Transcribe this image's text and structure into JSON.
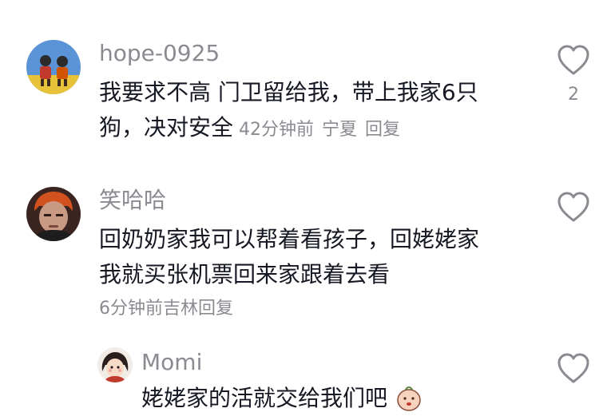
{
  "comments": [
    {
      "username": "hope-0925",
      "text_line1": "我要求不高 门卫留给我，带上我家6只",
      "text_line2": "狗，决对安全",
      "time": "42分钟前",
      "location": "宁夏",
      "reply_label": "回复",
      "like_count": "2",
      "avatar_icon": "kids-avatar-icon"
    },
    {
      "username": "笑哈哈",
      "text_line1": "回奶奶家我可以帮着看孩子，回姥姥家",
      "text_line2": "我就买张机票回来家跟着去看",
      "time": "6分钟前",
      "location": "吉林",
      "reply_label": "回复",
      "avatar_icon": "man-avatar-icon"
    },
    {
      "username": "Momi",
      "text_line1": "姥姥家的活就交给我们吧",
      "emoji_icon": "peach-face-emoji",
      "avatar_icon": "girl-avatar-icon"
    }
  ],
  "icons": {
    "like": "heart-outline-icon"
  },
  "colors": {
    "text": "#161823",
    "muted": "#8a8b91"
  }
}
